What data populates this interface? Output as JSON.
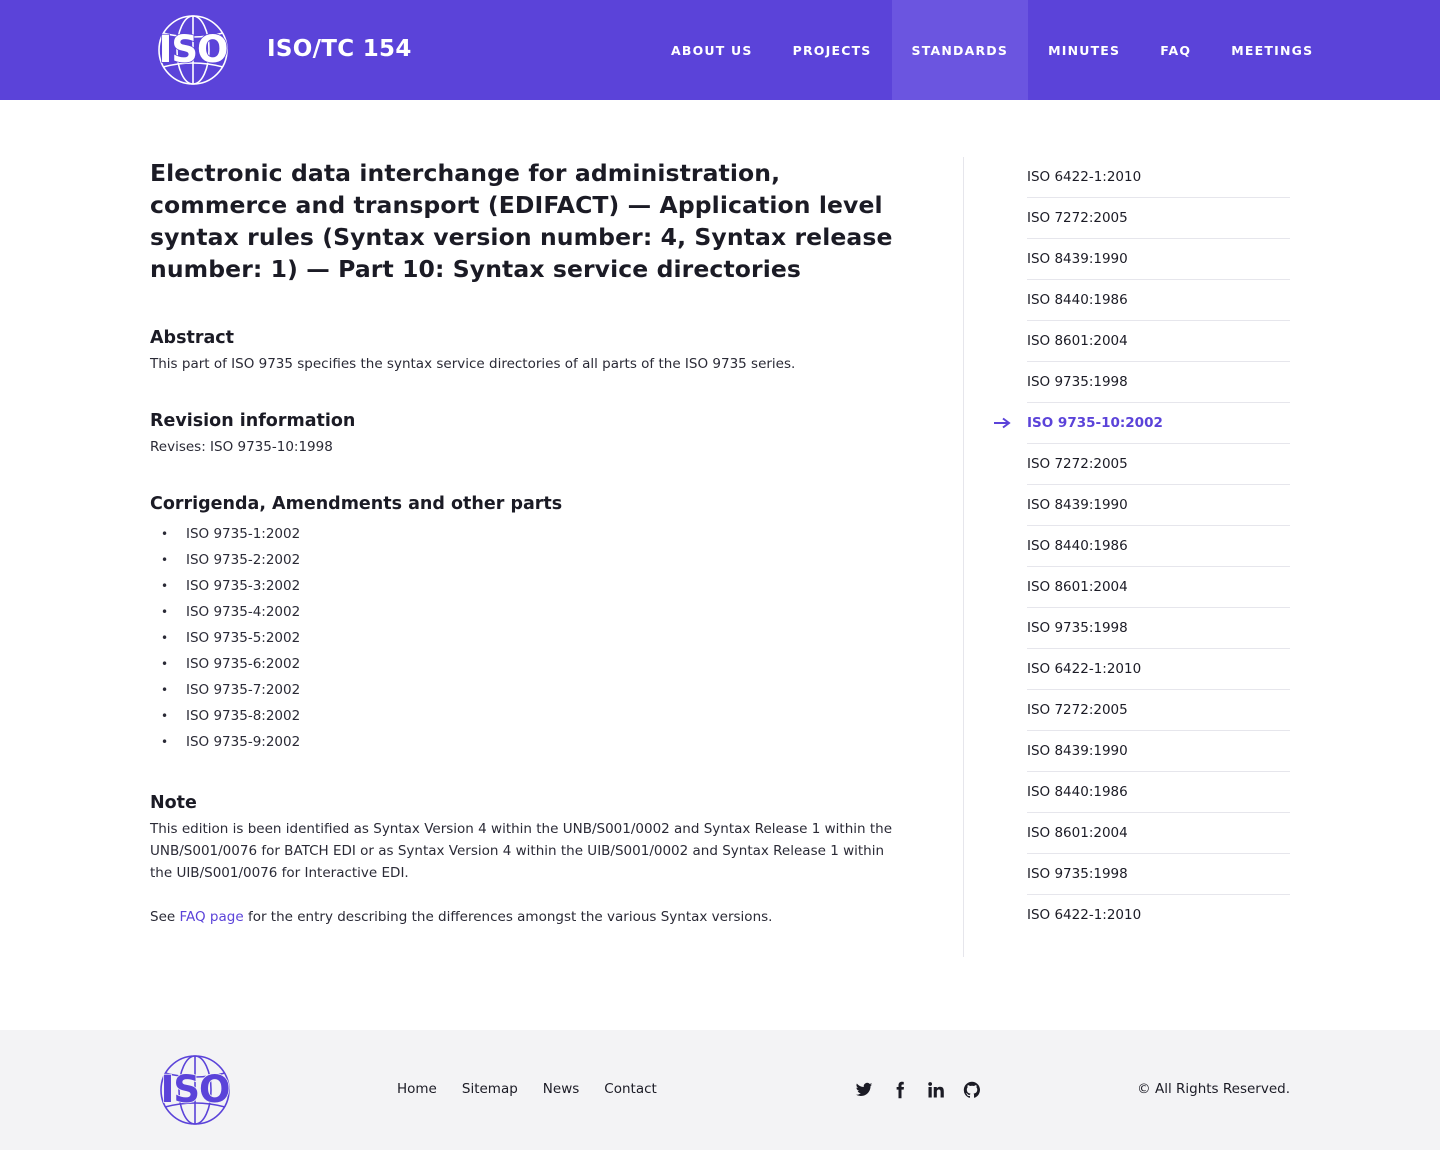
{
  "header": {
    "logo_text": "ISO",
    "site_title": "ISO/TC 154",
    "nav": [
      {
        "label": "ABOUT US"
      },
      {
        "label": "PROJECTS"
      },
      {
        "label": "STANDARDS"
      },
      {
        "label": "MINUTES"
      },
      {
        "label": "FAQ"
      },
      {
        "label": "MEETINGS"
      }
    ],
    "active_nav": "STANDARDS"
  },
  "main": {
    "title": "Electronic data interchange for administration, commerce and transport (EDIFACT) — Application level syntax rules (Syntax version number: 4, Syntax release number: 1) — Part 10: Syntax service directories",
    "abstract": {
      "heading": "Abstract",
      "text": "This part of ISO 9735 specifies the syntax service directories of all parts of the ISO 9735 series."
    },
    "revision": {
      "heading": "Revision information",
      "text": "Revises: ISO 9735-10:1998"
    },
    "corrigenda": {
      "heading": "Corrigenda, Amendments and other parts",
      "items": [
        "ISO 9735-1:2002",
        "ISO 9735-2:2002",
        "ISO 9735-3:2002",
        "ISO 9735-4:2002",
        "ISO 9735-5:2002",
        "ISO 9735-6:2002",
        "ISO 9735-7:2002",
        "ISO 9735-8:2002",
        "ISO 9735-9:2002"
      ]
    },
    "note": {
      "heading": "Note",
      "text": "This edition is been identified as Syntax Version 4 within the UNB/S001/0002 and Syntax Release 1 within the UNB/S001/0076 for BATCH EDI or as Syntax Version 4 within the UIB/S001/0002 and Syntax Release 1 within the UIB/S001/0076 for Interactive EDI.",
      "see_prefix": "See ",
      "see_link": "FAQ page",
      "see_suffix": " for the entry describing the differences amongst the various Syntax versions."
    }
  },
  "sidebar": {
    "items": [
      "ISO 6422-1:2010",
      "ISO 7272:2005",
      "ISO 8439:1990",
      "ISO 8440:1986",
      "ISO 8601:2004",
      "ISO 9735:1998",
      "ISO 9735-10:2002",
      "ISO 7272:2005",
      "ISO 8439:1990",
      "ISO 8440:1986",
      "ISO 8601:2004",
      "ISO 9735:1998",
      "ISO 6422-1:2010",
      "ISO 7272:2005",
      "ISO 8439:1990",
      "ISO 8440:1986",
      "ISO 8601:2004",
      "ISO 9735:1998",
      "ISO 6422-1:2010"
    ],
    "active_index": 6,
    "active_icon": "arrow-right-icon"
  },
  "footer": {
    "logo_text": "ISO",
    "links": [
      "Home",
      "Sitemap",
      "News",
      "Contact"
    ],
    "social_icons": [
      "twitter-icon",
      "facebook-icon",
      "linkedin-icon",
      "github-icon"
    ],
    "copyright": "© All Rights Reserved."
  },
  "colors": {
    "brand": "#5b43d9",
    "nav_active": "#6b55e0",
    "footer_bg": "#f3f3f5",
    "text": "#1b1b25"
  }
}
